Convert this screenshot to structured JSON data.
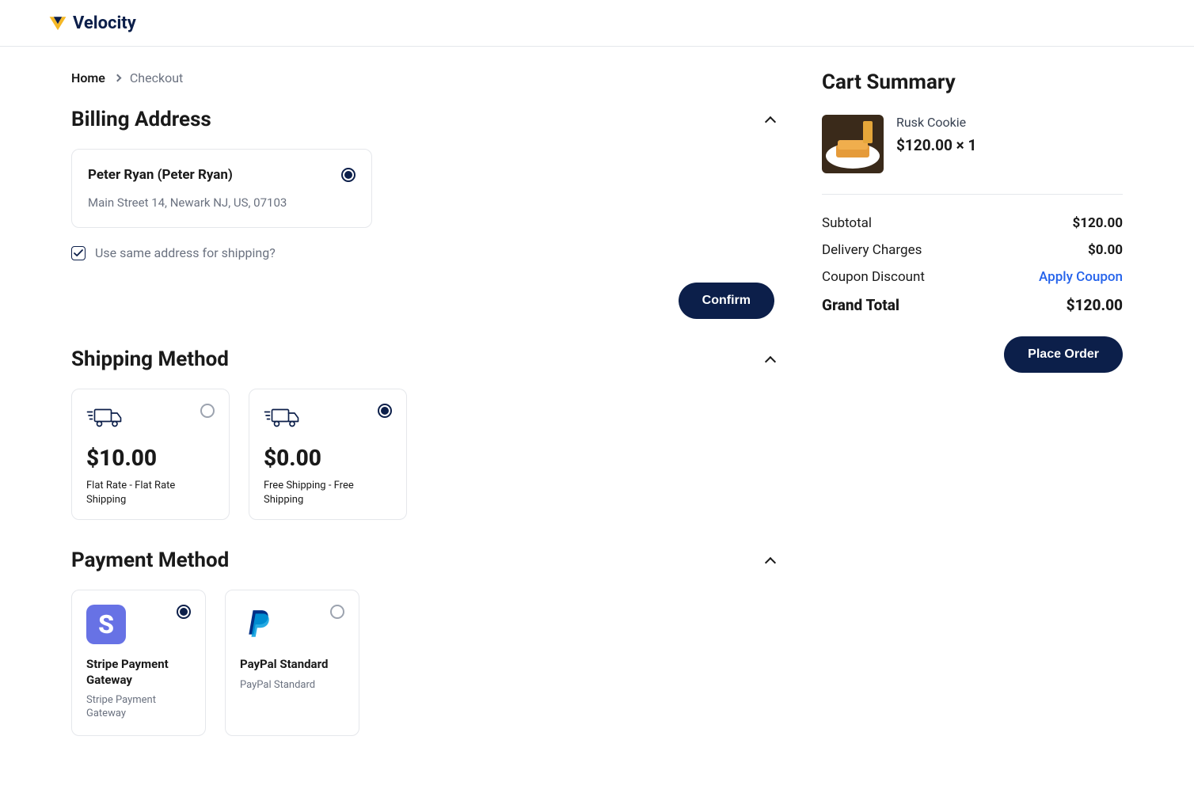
{
  "brand_name": "Velocity",
  "breadcrumb": {
    "home": "Home",
    "current": "Checkout"
  },
  "billing": {
    "heading": "Billing Address",
    "name": "Peter Ryan (Peter Ryan)",
    "address": "Main Street 14, Newark NJ, US, 07103",
    "same_label": "Use same address for shipping?",
    "confirm_label": "Confirm"
  },
  "shipping": {
    "heading": "Shipping Method",
    "options": [
      {
        "price": "$10.00",
        "label": "Flat Rate - Flat Rate Shipping",
        "selected": false
      },
      {
        "price": "$0.00",
        "label": "Free Shipping - Free Shipping",
        "selected": true
      }
    ]
  },
  "payment": {
    "heading": "Payment Method",
    "options": [
      {
        "title": "Stripe Payment Gateway",
        "sub": "Stripe Payment Gateway",
        "logo_letter": "S",
        "selected": true
      },
      {
        "title": "PayPal Standard",
        "sub": "PayPal Standard",
        "selected": false
      }
    ]
  },
  "cart": {
    "heading": "Cart Summary",
    "items": [
      {
        "name": "Rusk Cookie",
        "price_line": "$120.00 × 1"
      }
    ],
    "subtotal_label": "Subtotal",
    "subtotal_value": "$120.00",
    "delivery_label": "Delivery Charges",
    "delivery_value": "$0.00",
    "coupon_label": "Coupon Discount",
    "coupon_action": "Apply Coupon",
    "total_label": "Grand Total",
    "total_value": "$120.00",
    "place_label": "Place Order"
  }
}
